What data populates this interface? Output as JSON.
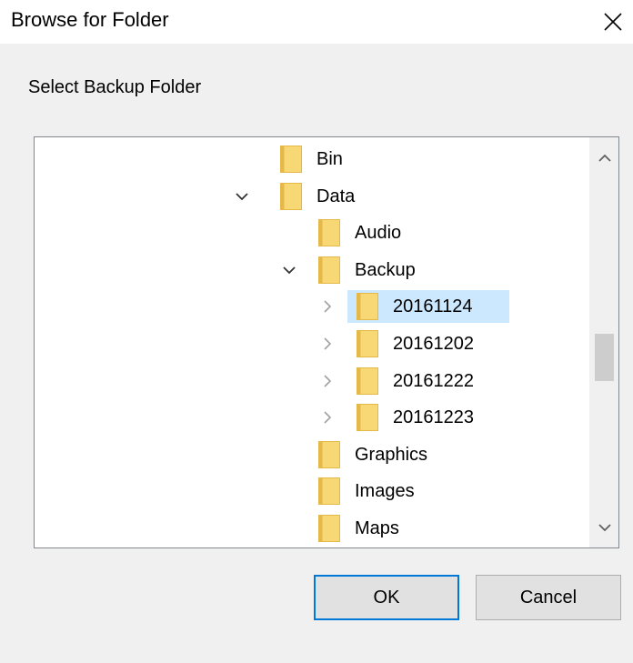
{
  "window": {
    "title": "Browse for Folder",
    "close_icon": "close-icon"
  },
  "instruction": "Select Backup Folder",
  "tree": {
    "items": [
      {
        "label": "Bin",
        "level": 0,
        "expander": "none",
        "selected": false
      },
      {
        "label": "Data",
        "level": 0,
        "expander": "expanded",
        "selected": false
      },
      {
        "label": "Audio",
        "level": 1,
        "expander": "none",
        "selected": false
      },
      {
        "label": "Backup",
        "level": 1,
        "expander": "expanded",
        "selected": false
      },
      {
        "label": "20161124",
        "level": 2,
        "expander": "collapsed",
        "selected": true
      },
      {
        "label": "20161202",
        "level": 2,
        "expander": "collapsed",
        "selected": false
      },
      {
        "label": "20161222",
        "level": 2,
        "expander": "collapsed",
        "selected": false
      },
      {
        "label": "20161223",
        "level": 2,
        "expander": "collapsed",
        "selected": false
      },
      {
        "label": "Graphics",
        "level": 1,
        "expander": "none",
        "selected": false
      },
      {
        "label": "Images",
        "level": 1,
        "expander": "none",
        "selected": false
      },
      {
        "label": "Maps",
        "level": 1,
        "expander": "none",
        "selected": false
      }
    ],
    "scroll_position": 0.55
  },
  "buttons": {
    "ok": "OK",
    "cancel": "Cancel"
  },
  "colors": {
    "selection": "#cce8ff",
    "folder": "#f8d775",
    "folder_dark": "#e4b94a",
    "default_button_border": "#0078d7"
  }
}
